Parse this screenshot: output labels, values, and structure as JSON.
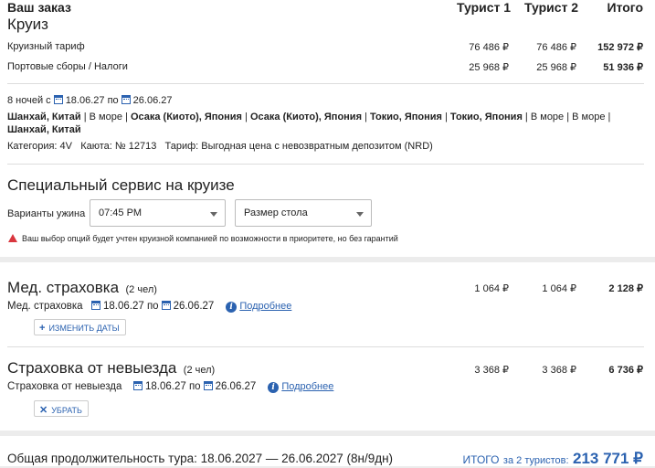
{
  "order": {
    "title": "Ваш заказ",
    "col_tourist1": "Турист 1",
    "col_tourist2": "Турист 2",
    "col_total": "Итого",
    "section_cruise": "Круиз",
    "rows": [
      {
        "label": "Круизный тариф",
        "t1": "76 486 ₽",
        "t2": "76 486 ₽",
        "total": "152 972 ₽"
      },
      {
        "label": "Портовые сборы / Налоги",
        "t1": "25 968 ₽",
        "t2": "25 968 ₽",
        "total": "51 936 ₽"
      }
    ],
    "dates_prefix": "8 ночей с",
    "date_from": "18.06.27",
    "dates_mid": "по",
    "date_to": "26.06.27",
    "route_line1": [
      "Шанхай, Китай",
      "В море",
      "Осака (Киото), Япония",
      "Осака (Киото), Япония",
      "Токио, Япония",
      "Токио, Япония",
      "В море",
      "В море"
    ],
    "route_line2": "Шанхай, Китай",
    "category_label": "Категория:",
    "category_value": "4V",
    "cabin_label": "Каюта: №",
    "cabin_value": "12713",
    "tariff_label": "Тариф:",
    "tariff_value": "Выгодная цена с невозвратным депозитом (NRD)"
  },
  "service": {
    "title": "Специальный сервис на круизе",
    "dinner_label": "Варианты ужина",
    "dinner_value": "07:45 PM",
    "table_size_placeholder": "Размер стола",
    "warning": "Ваш выбор опций будет учтен круизной компанией по возможности в приоритете, но без гарантий"
  },
  "insurance": {
    "med": {
      "title": "Мед. страховка",
      "count": "(2 чел)",
      "t1": "1 064 ₽",
      "t2": "1 064 ₽",
      "total": "2 128 ₽",
      "sub_label": "Мед. страховка",
      "date_from": "18.06.27",
      "mid": "по",
      "date_to": "26.06.27",
      "more": "Подробнее",
      "button": "ИЗМЕНИТЬ ДАТЫ"
    },
    "cancel": {
      "title": "Страховка от невыезда",
      "count": "(2 чел)",
      "t1": "3 368 ₽",
      "t2": "3 368 ₽",
      "total": "6 736 ₽",
      "sub_label": "Страховка от невыезда",
      "date_from": "18.06.27",
      "mid": "по",
      "date_to": "26.06.27",
      "more": "Подробнее",
      "button": "УБРАТЬ"
    }
  },
  "summary": {
    "duration": "Общая продолжительность тура: 18.06.2027 — 26.06.2027 (8н/9дн)",
    "total_label": "ИТОГО",
    "total_for": "за 2 туристов:",
    "total_value": "213 771 ₽"
  },
  "colors": {
    "accent": "#2b62b0",
    "warning": "#d9363e"
  }
}
